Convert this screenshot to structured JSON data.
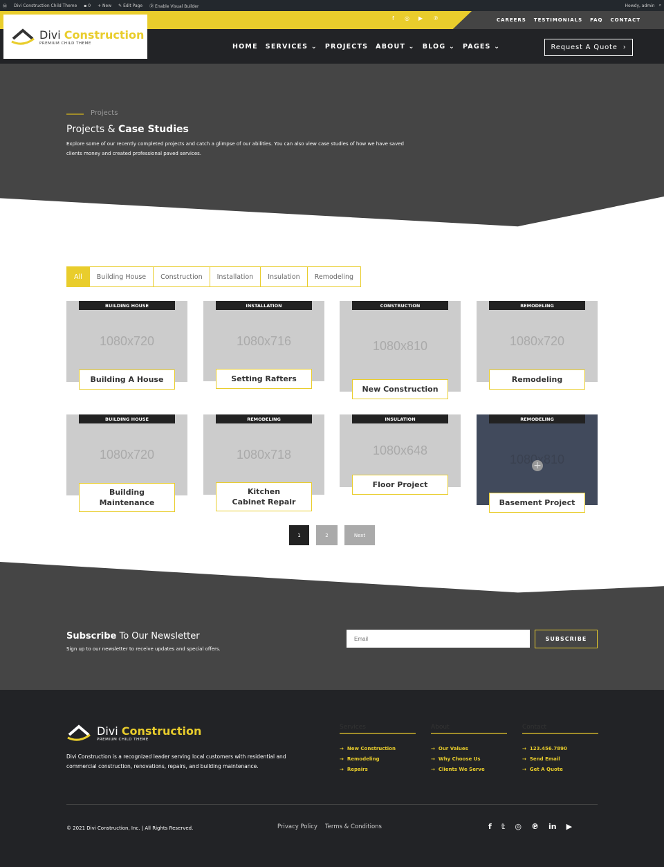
{
  "adminbar": {
    "site": "Divi Construction Child Theme",
    "comments": "0",
    "new": "New",
    "edit": "Edit Page",
    "builder": "Enable Visual Builder",
    "howdy": "Howdy, admin"
  },
  "topbar": {
    "links": [
      "CAREERS",
      "TESTIMONIALS",
      "FAQ",
      "CONTACT"
    ],
    "social": [
      "facebook-icon",
      "instagram-icon",
      "youtube-icon",
      "pinterest-icon"
    ]
  },
  "logo": {
    "name1": "Divi",
    "name2": "Construction",
    "tag": "PREMIUM CHILD THEME"
  },
  "nav": {
    "items": [
      "HOME",
      "SERVICES ⌄",
      "PROJECTS",
      "ABOUT ⌄",
      "BLOG ⌄",
      "PAGES ⌄"
    ],
    "cta": "Request A Quote"
  },
  "hero": {
    "crumb": "Projects",
    "title1": "Projects & ",
    "title2": "Case Studies",
    "desc": "Explore some of our recently completed projects and catch a glimpse of our abilities. You can also view case studies of how we have saved clients money and created professional paved services."
  },
  "filters": [
    "All",
    "Building House",
    "Construction",
    "Installation",
    "Insulation",
    "Remodeling"
  ],
  "projects": [
    {
      "cat": "BUILDING HOUSE",
      "size": "1080x720",
      "title": "Building A House"
    },
    {
      "cat": "INSTALLATION",
      "size": "1080x716",
      "title": "Setting Rafters"
    },
    {
      "cat": "CONSTRUCTION",
      "size": "1080x810",
      "title": "New Construction"
    },
    {
      "cat": "REMODELING",
      "size": "1080x720",
      "title": "Remodeling"
    },
    {
      "cat": "BUILDING HOUSE",
      "size": "1080x720",
      "title": "Building Maintenance"
    },
    {
      "cat": "REMODELING",
      "size": "1080x718",
      "title": "Kitchen Cabinet Repair"
    },
    {
      "cat": "INSULATION",
      "size": "1080x648",
      "title": "Floor Project"
    },
    {
      "cat": "REMODELING",
      "size": "1080x810",
      "title": "Basement Project",
      "hover": true
    }
  ],
  "pagination": {
    "pages": [
      "1",
      "2"
    ],
    "next": "Next",
    "current": "1"
  },
  "newsletter": {
    "title1": "Subscribe",
    "title2": " To Our Newsletter",
    "desc": "Sign up to our newsletter to receive updates and special offers.",
    "placeholder": "Email",
    "button": "SUBSCRIBE"
  },
  "footer": {
    "desc": "Divi Construction is a recognized leader serving local customers with residential and commercial construction, renovations,  repairs, and building maintenance.",
    "columns": [
      {
        "heading": "Services",
        "links": [
          "New Construction",
          "Remodeling",
          "Repairs"
        ]
      },
      {
        "heading": "About",
        "links": [
          "Our Values",
          "Why Choose Us",
          "Clients We Serve"
        ]
      },
      {
        "heading": "Contact",
        "links": [
          "123.456.7890",
          "Send Email",
          "Get A Quote"
        ]
      }
    ],
    "copyright": "© 2021 Divi Construction, Inc. | All Rights Reserved.",
    "links": [
      "Privacy Policy",
      "Terms & Conditions"
    ],
    "social": [
      "facebook-icon",
      "twitter-icon",
      "instagram-icon",
      "pinterest-icon",
      "linkedin-icon",
      "youtube-icon"
    ]
  },
  "colors": {
    "accent": "#e9cd2c",
    "dark": "#222326",
    "hero": "#454545"
  }
}
